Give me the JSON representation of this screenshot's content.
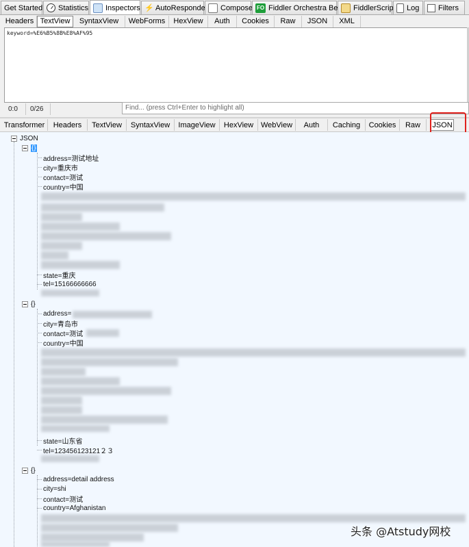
{
  "top_tabs": [
    {
      "label": "Get Started",
      "icon": "none",
      "active": false
    },
    {
      "label": "Statistics",
      "icon": "stopwatch-icon",
      "active": false
    },
    {
      "label": "Inspectors",
      "icon": "inspectors-icon",
      "active": true
    },
    {
      "label": "AutoResponder",
      "icon": "lightning-icon",
      "active": false
    },
    {
      "label": "Composer",
      "icon": "compose-icon",
      "active": false
    },
    {
      "label": "Fiddler Orchestra Beta",
      "icon": "fo-icon",
      "icon_text": "FO",
      "active": false
    },
    {
      "label": "FiddlerScript",
      "icon": "script-icon",
      "active": false
    },
    {
      "label": "Log",
      "icon": "log-icon",
      "active": false
    },
    {
      "label": "Filters",
      "icon": "checkbox-icon",
      "active": false
    }
  ],
  "request_tabs": [
    "Headers",
    "TextView",
    "SyntaxView",
    "WebForms",
    "HexView",
    "Auth",
    "Cookies",
    "Raw",
    "JSON",
    "XML"
  ],
  "request_active_tab": "TextView",
  "request_body": "keyword=%E6%B5%8B%E8%AF%95",
  "status": {
    "position": "0:0",
    "count": "0/26"
  },
  "find": {
    "placeholder": "Find... (press Ctrl+Enter to highlight all)"
  },
  "response_tabs": [
    "Transformer",
    "Headers",
    "TextView",
    "SyntaxView",
    "ImageView",
    "HexView",
    "WebView",
    "Auth",
    "Caching",
    "Cookies",
    "Raw",
    "JSON"
  ],
  "response_active_tab": "JSON",
  "tree": {
    "root": "JSON",
    "object_label": "{}",
    "items": [
      {
        "address": "address=测试地址",
        "city": "city=重庆市",
        "contact": "contact=测试",
        "country": "country=中国",
        "state": "state=重庆",
        "tel": "tel=15166666666"
      },
      {
        "address": "address=",
        "city": "city=青岛市",
        "contact": "contact=测试",
        "country": "country=中国",
        "state": "state=山东省",
        "tel": "tel=123456123121２３"
      },
      {
        "address": "address=detail address",
        "city": "city=shi",
        "contact": "contact=测试",
        "country": "country=Afghanistan"
      }
    ]
  },
  "watermark": "头条 @Atstudy网校",
  "colors": {
    "selection": "#3399ff",
    "tree_bg": "#f2f8ff",
    "highlight_box": "#e0201c"
  }
}
